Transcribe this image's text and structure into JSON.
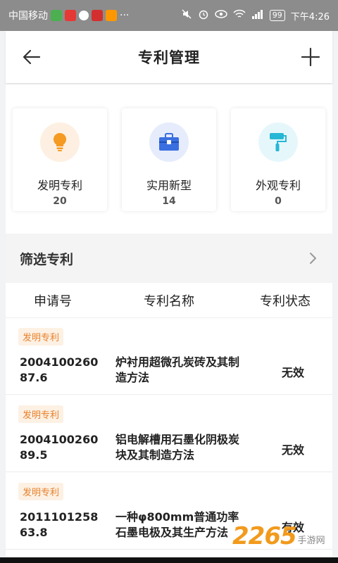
{
  "status_bar": {
    "carrier": "中国移动",
    "battery": "99",
    "time": "下午4:26",
    "more": "···"
  },
  "header": {
    "title": "专利管理"
  },
  "cards": [
    {
      "label": "发明专利",
      "count": "20",
      "icon": "lightbulb-icon",
      "bg": "#fdf0e2",
      "color": "#f59a23"
    },
    {
      "label": "实用新型",
      "count": "14",
      "icon": "toolbox-icon",
      "bg": "#e6ecfb",
      "color": "#3a6fe0"
    },
    {
      "label": "外观专利",
      "count": "0",
      "icon": "paint-roller-icon",
      "bg": "#e6f7fb",
      "color": "#27b7d6"
    }
  ],
  "filter": {
    "title": "筛选专利"
  },
  "table": {
    "headers": [
      "申请号",
      "专利名称",
      "专利状态"
    ],
    "rows": [
      {
        "badge": "发明专利",
        "app_no": "200410026087.6",
        "name": "炉衬用超微孔炭砖及其制造方法",
        "status": "无效"
      },
      {
        "badge": "发明专利",
        "app_no": "200410026089.5",
        "name": "铝电解槽用石墨化阴极炭块及其制造方法",
        "status": "无效"
      },
      {
        "badge": "发明专利",
        "app_no": "201110125863.8",
        "name": "一种φ800mm普通功率石墨电极及其生产方法",
        "status": "有效"
      }
    ]
  },
  "watermark": {
    "number": "2265",
    "text": "手游网"
  },
  "colors": {
    "accent_orange": "#e7812b",
    "status_bar_bg": "#8c8c8c"
  }
}
